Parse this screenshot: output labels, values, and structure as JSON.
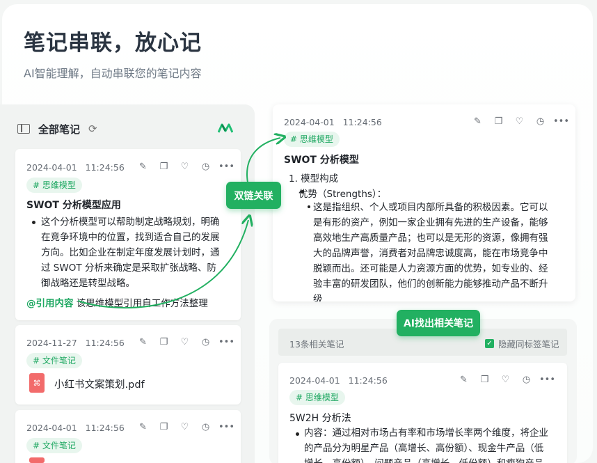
{
  "hero": {
    "title": "笔记串联，放心记",
    "subtitle": "AI智能理解，自动串联您的笔记内容"
  },
  "left_panel": {
    "title": "全部笔记",
    "icons": [
      "sidebar-toggle-icon",
      "refresh-icon",
      "brand-logo"
    ]
  },
  "notes": [
    {
      "date": "2024-04-01",
      "time": "11:24:56",
      "tag": "# 思维模型",
      "title": "SWOT 分析模型应用",
      "bullet": [
        "这个分析模型可以帮助制定战略规划，明确",
        "在竞争环境中的位置，找到适合自己的发展",
        "方向。比如企业在制定年度发展计划时，通",
        "过 SWOT 分析来确定是采取扩张战略、防",
        "御战略还是转型战略。"
      ],
      "mention": "@引用内容",
      "ref_text": "该思维模型引用自工作方法整理"
    },
    {
      "date": "2024-11-27",
      "time": "11:24:56",
      "tag": "# 文件笔记",
      "file_name": "小红书文案策划.pdf"
    },
    {
      "date": "2024-04-01",
      "time": "11:24:56",
      "tag": "# 文件笔记"
    }
  ],
  "actions": [
    "edit-icon",
    "copy-icon",
    "heart-icon",
    "clock-icon",
    "more-icon"
  ],
  "link_button": "双链关联",
  "detail_note": {
    "date": "2024-04-01",
    "time": "11:24:56",
    "tag": "# 思维模型",
    "title": "SWOT 分析模型",
    "item1": "1. 模型构成",
    "sub_bullet": "优势（Strengths）：",
    "lines": [
      "这是指组织、个人或项目内部所具备的积极因素。它可以",
      "是有形的资产，例如一家企业拥有先进的生产设备，能够",
      "高效地生产高质量产品；也可以是无形的资源，像拥有强",
      "大的品牌声誉，消费者对品牌忠诚度高，能在市场竞争中",
      "脱颖而出。还可能是人力资源方面的优势，如专业的、经",
      "验丰富的研发团队，他们的创新能力能够推动产品不断升",
      "级"
    ]
  },
  "ai_button": "AI找出相关笔记",
  "related": {
    "count": "13条相关笔记",
    "hide_label": "隐藏同标签笔记",
    "note": {
      "date": "2024-04-01",
      "time": "11:24:56",
      "tag": "# 思维模型",
      "title": "5W2H 分析法",
      "lines": [
        "内容：通过相对市场占有率和市场增长率两个维度，将企业",
        "的产品分为明星产品（高增长、高份额）、现金牛产品（低",
        "增长、高份额）、问题产品（高增长、低份额）和瘦狗产品"
      ]
    }
  },
  "colors": {
    "accent": "#22b061",
    "tag_bg": "#e8f6ee",
    "tag_text": "#1fa862",
    "pdf": "#f26b6b"
  }
}
